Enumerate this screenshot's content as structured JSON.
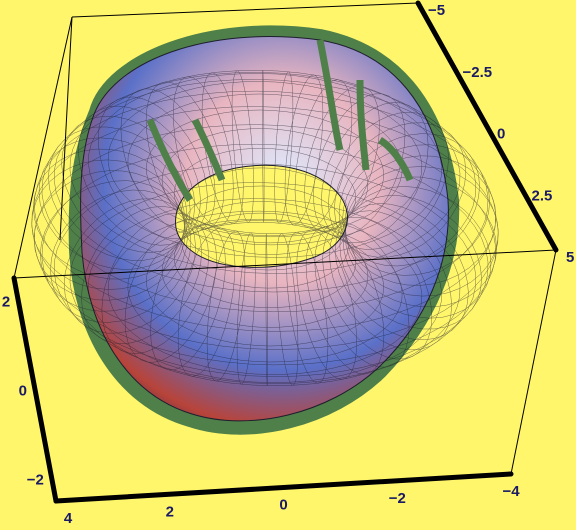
{
  "chart_data": {
    "type": "surface3d",
    "title": "",
    "surface": "torus",
    "colors": {
      "background": "#FFF66B",
      "box_edges": "#000000",
      "curve": "#4F8049",
      "tick_labels": "#1a1a66",
      "surface_highlight": "#DDEBFF",
      "surface_pink": "#E8B5C0",
      "surface_blue": "#5A70C8",
      "surface_red": "#B8443A",
      "surface_dark": "#2A1F4F"
    },
    "axes": {
      "x": {
        "label": "",
        "range": [
          -4,
          4
        ],
        "ticks": [
          {
            "value": 4,
            "label": "4"
          },
          {
            "value": 2,
            "label": "2"
          },
          {
            "value": 0,
            "label": "0"
          },
          {
            "value": -2,
            "label": "−2"
          },
          {
            "value": -4,
            "label": "−4"
          }
        ]
      },
      "y": {
        "label": "",
        "range": [
          -5,
          5
        ],
        "ticks": [
          {
            "value": -5,
            "label": "−5"
          },
          {
            "value": -2.5,
            "label": "−2.5"
          },
          {
            "value": 0,
            "label": "0"
          },
          {
            "value": 2.5,
            "label": "2.5"
          },
          {
            "value": 5,
            "label": "5"
          }
        ]
      },
      "z": {
        "label": "",
        "range": [
          -2.5,
          2.5
        ],
        "ticks": [
          {
            "value": 2,
            "label": "2"
          },
          {
            "value": 0,
            "label": "0"
          },
          {
            "value": -2,
            "label": "−2"
          }
        ]
      }
    },
    "grid": false,
    "legend": "none"
  }
}
